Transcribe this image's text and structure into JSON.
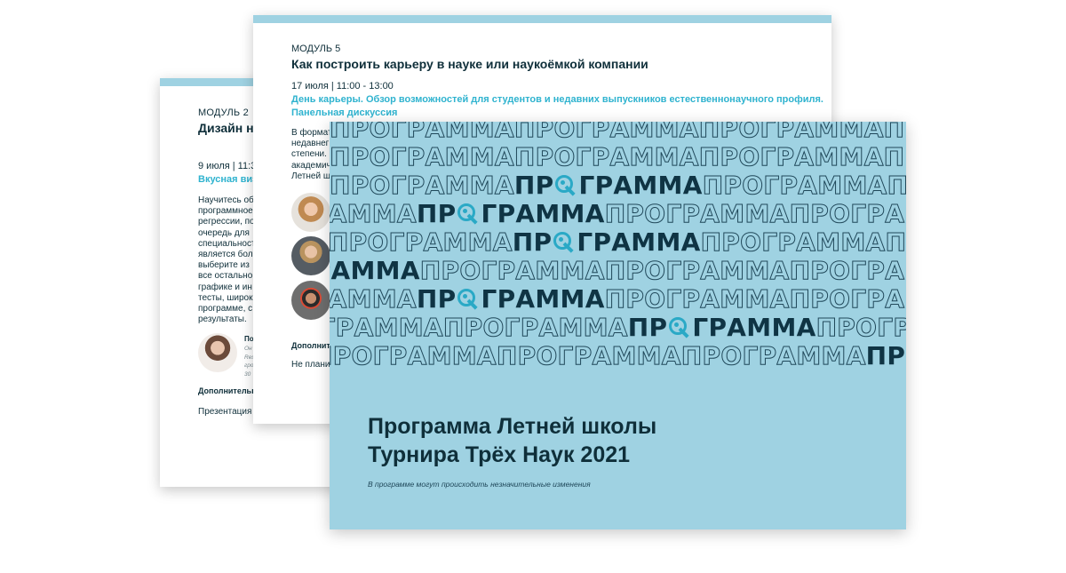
{
  "module2": {
    "label": "МОДУЛЬ 2",
    "title": "Дизайн на",
    "date": "9 июля | 11:3",
    "event": "Вкусная виз",
    "body_lines": [
      "Научитесь об",
      "программное",
      "регрессии, по",
      "очередь для",
      "специальност",
      "является бол",
      "выберите из",
      "все остально",
      "графике и ин",
      "тесты, широк",
      "программе, с",
      "результаты."
    ],
    "speaker_name": "По",
    "speaker_info": [
      "Он",
      "Res",
      "гро",
      "30"
    ],
    "extra_label": "Дополнительн",
    "extra_text": "Презентация с"
  },
  "module5": {
    "label": "МОДУЛЬ 5",
    "title": "Как построить карьеру в науке или наукоёмкой компании",
    "date": "17 июля | 11:00 - 13:00",
    "event_lines": [
      "День карьеры. Обзор возможностей для студентов и недавних выпускников естественнонаучного профиля.",
      "Панельная дискуссия"
    ],
    "body_lines": [
      "В формат",
      "недавнег",
      "степени.",
      "академич",
      "Летней ш"
    ],
    "extra_label": "Дополнит",
    "extra_text": "Не планир"
  },
  "cover": {
    "pattern_word": "ПРОГРАММА",
    "solid_prefix": "ПР",
    "solid_suffix": "ГРАММА",
    "title_lines": [
      "Программа Летней школы",
      "Турнира Трёх Наук 2021"
    ],
    "note": "В программе могут происходить незначительные изменения"
  },
  "colors": {
    "accent": "#2aa9c6",
    "cover_bg": "#9fd2e2",
    "dark": "#0f2f3a"
  },
  "icons": [
    "target-arrow-icon"
  ]
}
